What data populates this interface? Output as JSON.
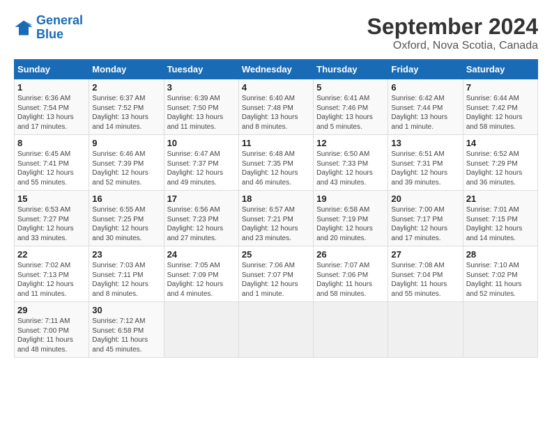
{
  "logo": {
    "line1": "General",
    "line2": "Blue"
  },
  "title": "September 2024",
  "subtitle": "Oxford, Nova Scotia, Canada",
  "days_header": [
    "Sunday",
    "Monday",
    "Tuesday",
    "Wednesday",
    "Thursday",
    "Friday",
    "Saturday"
  ],
  "weeks": [
    [
      {
        "num": "1",
        "sunrise": "Sunrise: 6:36 AM",
        "sunset": "Sunset: 7:54 PM",
        "daylight": "Daylight: 13 hours and 17 minutes."
      },
      {
        "num": "2",
        "sunrise": "Sunrise: 6:37 AM",
        "sunset": "Sunset: 7:52 PM",
        "daylight": "Daylight: 13 hours and 14 minutes."
      },
      {
        "num": "3",
        "sunrise": "Sunrise: 6:39 AM",
        "sunset": "Sunset: 7:50 PM",
        "daylight": "Daylight: 13 hours and 11 minutes."
      },
      {
        "num": "4",
        "sunrise": "Sunrise: 6:40 AM",
        "sunset": "Sunset: 7:48 PM",
        "daylight": "Daylight: 13 hours and 8 minutes."
      },
      {
        "num": "5",
        "sunrise": "Sunrise: 6:41 AM",
        "sunset": "Sunset: 7:46 PM",
        "daylight": "Daylight: 13 hours and 5 minutes."
      },
      {
        "num": "6",
        "sunrise": "Sunrise: 6:42 AM",
        "sunset": "Sunset: 7:44 PM",
        "daylight": "Daylight: 13 hours and 1 minute."
      },
      {
        "num": "7",
        "sunrise": "Sunrise: 6:44 AM",
        "sunset": "Sunset: 7:42 PM",
        "daylight": "Daylight: 12 hours and 58 minutes."
      }
    ],
    [
      {
        "num": "8",
        "sunrise": "Sunrise: 6:45 AM",
        "sunset": "Sunset: 7:41 PM",
        "daylight": "Daylight: 12 hours and 55 minutes."
      },
      {
        "num": "9",
        "sunrise": "Sunrise: 6:46 AM",
        "sunset": "Sunset: 7:39 PM",
        "daylight": "Daylight: 12 hours and 52 minutes."
      },
      {
        "num": "10",
        "sunrise": "Sunrise: 6:47 AM",
        "sunset": "Sunset: 7:37 PM",
        "daylight": "Daylight: 12 hours and 49 minutes."
      },
      {
        "num": "11",
        "sunrise": "Sunrise: 6:48 AM",
        "sunset": "Sunset: 7:35 PM",
        "daylight": "Daylight: 12 hours and 46 minutes."
      },
      {
        "num": "12",
        "sunrise": "Sunrise: 6:50 AM",
        "sunset": "Sunset: 7:33 PM",
        "daylight": "Daylight: 12 hours and 43 minutes."
      },
      {
        "num": "13",
        "sunrise": "Sunrise: 6:51 AM",
        "sunset": "Sunset: 7:31 PM",
        "daylight": "Daylight: 12 hours and 39 minutes."
      },
      {
        "num": "14",
        "sunrise": "Sunrise: 6:52 AM",
        "sunset": "Sunset: 7:29 PM",
        "daylight": "Daylight: 12 hours and 36 minutes."
      }
    ],
    [
      {
        "num": "15",
        "sunrise": "Sunrise: 6:53 AM",
        "sunset": "Sunset: 7:27 PM",
        "daylight": "Daylight: 12 hours and 33 minutes."
      },
      {
        "num": "16",
        "sunrise": "Sunrise: 6:55 AM",
        "sunset": "Sunset: 7:25 PM",
        "daylight": "Daylight: 12 hours and 30 minutes."
      },
      {
        "num": "17",
        "sunrise": "Sunrise: 6:56 AM",
        "sunset": "Sunset: 7:23 PM",
        "daylight": "Daylight: 12 hours and 27 minutes."
      },
      {
        "num": "18",
        "sunrise": "Sunrise: 6:57 AM",
        "sunset": "Sunset: 7:21 PM",
        "daylight": "Daylight: 12 hours and 23 minutes."
      },
      {
        "num": "19",
        "sunrise": "Sunrise: 6:58 AM",
        "sunset": "Sunset: 7:19 PM",
        "daylight": "Daylight: 12 hours and 20 minutes."
      },
      {
        "num": "20",
        "sunrise": "Sunrise: 7:00 AM",
        "sunset": "Sunset: 7:17 PM",
        "daylight": "Daylight: 12 hours and 17 minutes."
      },
      {
        "num": "21",
        "sunrise": "Sunrise: 7:01 AM",
        "sunset": "Sunset: 7:15 PM",
        "daylight": "Daylight: 12 hours and 14 minutes."
      }
    ],
    [
      {
        "num": "22",
        "sunrise": "Sunrise: 7:02 AM",
        "sunset": "Sunset: 7:13 PM",
        "daylight": "Daylight: 12 hours and 11 minutes."
      },
      {
        "num": "23",
        "sunrise": "Sunrise: 7:03 AM",
        "sunset": "Sunset: 7:11 PM",
        "daylight": "Daylight: 12 hours and 8 minutes."
      },
      {
        "num": "24",
        "sunrise": "Sunrise: 7:05 AM",
        "sunset": "Sunset: 7:09 PM",
        "daylight": "Daylight: 12 hours and 4 minutes."
      },
      {
        "num": "25",
        "sunrise": "Sunrise: 7:06 AM",
        "sunset": "Sunset: 7:07 PM",
        "daylight": "Daylight: 12 hours and 1 minute."
      },
      {
        "num": "26",
        "sunrise": "Sunrise: 7:07 AM",
        "sunset": "Sunset: 7:06 PM",
        "daylight": "Daylight: 11 hours and 58 minutes."
      },
      {
        "num": "27",
        "sunrise": "Sunrise: 7:08 AM",
        "sunset": "Sunset: 7:04 PM",
        "daylight": "Daylight: 11 hours and 55 minutes."
      },
      {
        "num": "28",
        "sunrise": "Sunrise: 7:10 AM",
        "sunset": "Sunset: 7:02 PM",
        "daylight": "Daylight: 11 hours and 52 minutes."
      }
    ],
    [
      {
        "num": "29",
        "sunrise": "Sunrise: 7:11 AM",
        "sunset": "Sunset: 7:00 PM",
        "daylight": "Daylight: 11 hours and 48 minutes."
      },
      {
        "num": "30",
        "sunrise": "Sunrise: 7:12 AM",
        "sunset": "Sunset: 6:58 PM",
        "daylight": "Daylight: 11 hours and 45 minutes."
      },
      null,
      null,
      null,
      null,
      null
    ]
  ]
}
